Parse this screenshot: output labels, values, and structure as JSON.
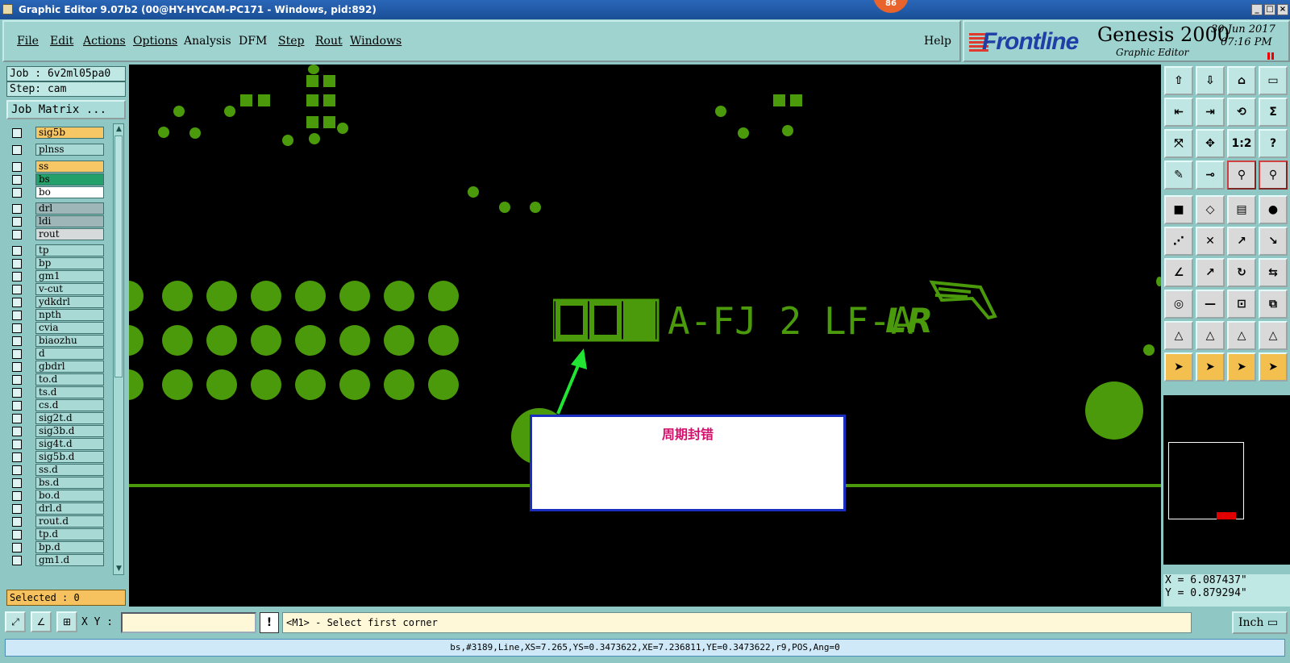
{
  "window": {
    "title": "Graphic Editor 9.07b2 (00@HY-HYCAM-PC171 - Windows, pid:892)",
    "badge": "86"
  },
  "menu": {
    "items": [
      "File",
      "Edit",
      "Actions",
      "Options",
      "Analysis",
      "DFM",
      "Step",
      "Rout",
      "Windows"
    ],
    "help": "Help"
  },
  "brand": {
    "logo": "Frontline",
    "product": "Genesis 2000",
    "subtitle": "Graphic Editor",
    "date": "30 Jun 2017",
    "time": "07:16 PM"
  },
  "job": {
    "job_label": "Job : 6v2ml05pa0",
    "step_label": "Step: cam",
    "matrix_button": "Job Matrix ..."
  },
  "layers": [
    {
      "name": "sig5b",
      "style": "orange"
    },
    {
      "name": "plnss",
      "style": "default"
    },
    {
      "name": "ss",
      "style": "orange"
    },
    {
      "name": "bs",
      "style": "green"
    },
    {
      "name": "bo",
      "style": "white"
    },
    {
      "name": "drl",
      "style": "gray"
    },
    {
      "name": "ldi",
      "style": "gray"
    },
    {
      "name": "rout",
      "style": "lgray"
    },
    {
      "name": "tp",
      "style": "default"
    },
    {
      "name": "bp",
      "style": "default"
    },
    {
      "name": "gm1",
      "style": "default"
    },
    {
      "name": "v-cut",
      "style": "default"
    },
    {
      "name": "ydkdrl",
      "style": "default"
    },
    {
      "name": "npth",
      "style": "default"
    },
    {
      "name": "cvia",
      "style": "default"
    },
    {
      "name": "biaozhu",
      "style": "default"
    },
    {
      "name": "d",
      "style": "default"
    },
    {
      "name": "gbdrl",
      "style": "default"
    },
    {
      "name": "to.d",
      "style": "default"
    },
    {
      "name": "ts.d",
      "style": "default"
    },
    {
      "name": "cs.d",
      "style": "default"
    },
    {
      "name": "sig2t.d",
      "style": "default"
    },
    {
      "name": "sig3b.d",
      "style": "default"
    },
    {
      "name": "sig4t.d",
      "style": "default"
    },
    {
      "name": "sig5b.d",
      "style": "default"
    },
    {
      "name": "ss.d",
      "style": "default"
    },
    {
      "name": "bs.d",
      "style": "default"
    },
    {
      "name": "bo.d",
      "style": "default"
    },
    {
      "name": "drl.d",
      "style": "default"
    },
    {
      "name": "rout.d",
      "style": "default"
    },
    {
      "name": "tp.d",
      "style": "default"
    },
    {
      "name": "bp.d",
      "style": "default"
    },
    {
      "name": "gm1.d",
      "style": "default"
    }
  ],
  "selected": "Selected : 0",
  "canvas": {
    "note_text": "周期封错",
    "silk_text": "A-FJ 2 LF-A",
    "copper_color": "#4a9a0b"
  },
  "coords": {
    "x": "X = 6.087437\"",
    "y": "Y = 0.879294\""
  },
  "bottom": {
    "xy_label": "X Y :",
    "warn": "!",
    "prompt": "<M1> - Select first corner",
    "units": "Inch"
  },
  "status": "bs,#3189,Line,XS=7.265,YS=0.3473622,XE=7.236811,YE=0.3473622,r9,POS,Ang=0",
  "toolbar": [
    "snap-up-icon",
    "snap-down-icon",
    "home-icon",
    "window-icon",
    "left-icon",
    "right-icon",
    "pan-icon",
    "sum-icon",
    "fit-icon",
    "center-icon",
    "ratio-icon",
    "help-icon",
    "edit-icon",
    "probe-icon",
    "net-icon",
    "net2-icon",
    "square-icon",
    "polygon-icon",
    "ruler-icon",
    "circle-icon",
    "nodes-icon",
    "delete-icon",
    "move-icon",
    "copy-icon",
    "line-icon",
    "arrow-icon",
    "rotate-icon",
    "mirror-icon",
    "snap-point-icon",
    "cut-icon",
    "measure-icon",
    "group-icon",
    "triangle-icon",
    "tri2-icon",
    "tri3-icon",
    "tri4-icon",
    "select-icon",
    "select2-icon",
    "select3-icon",
    "select4-icon"
  ]
}
